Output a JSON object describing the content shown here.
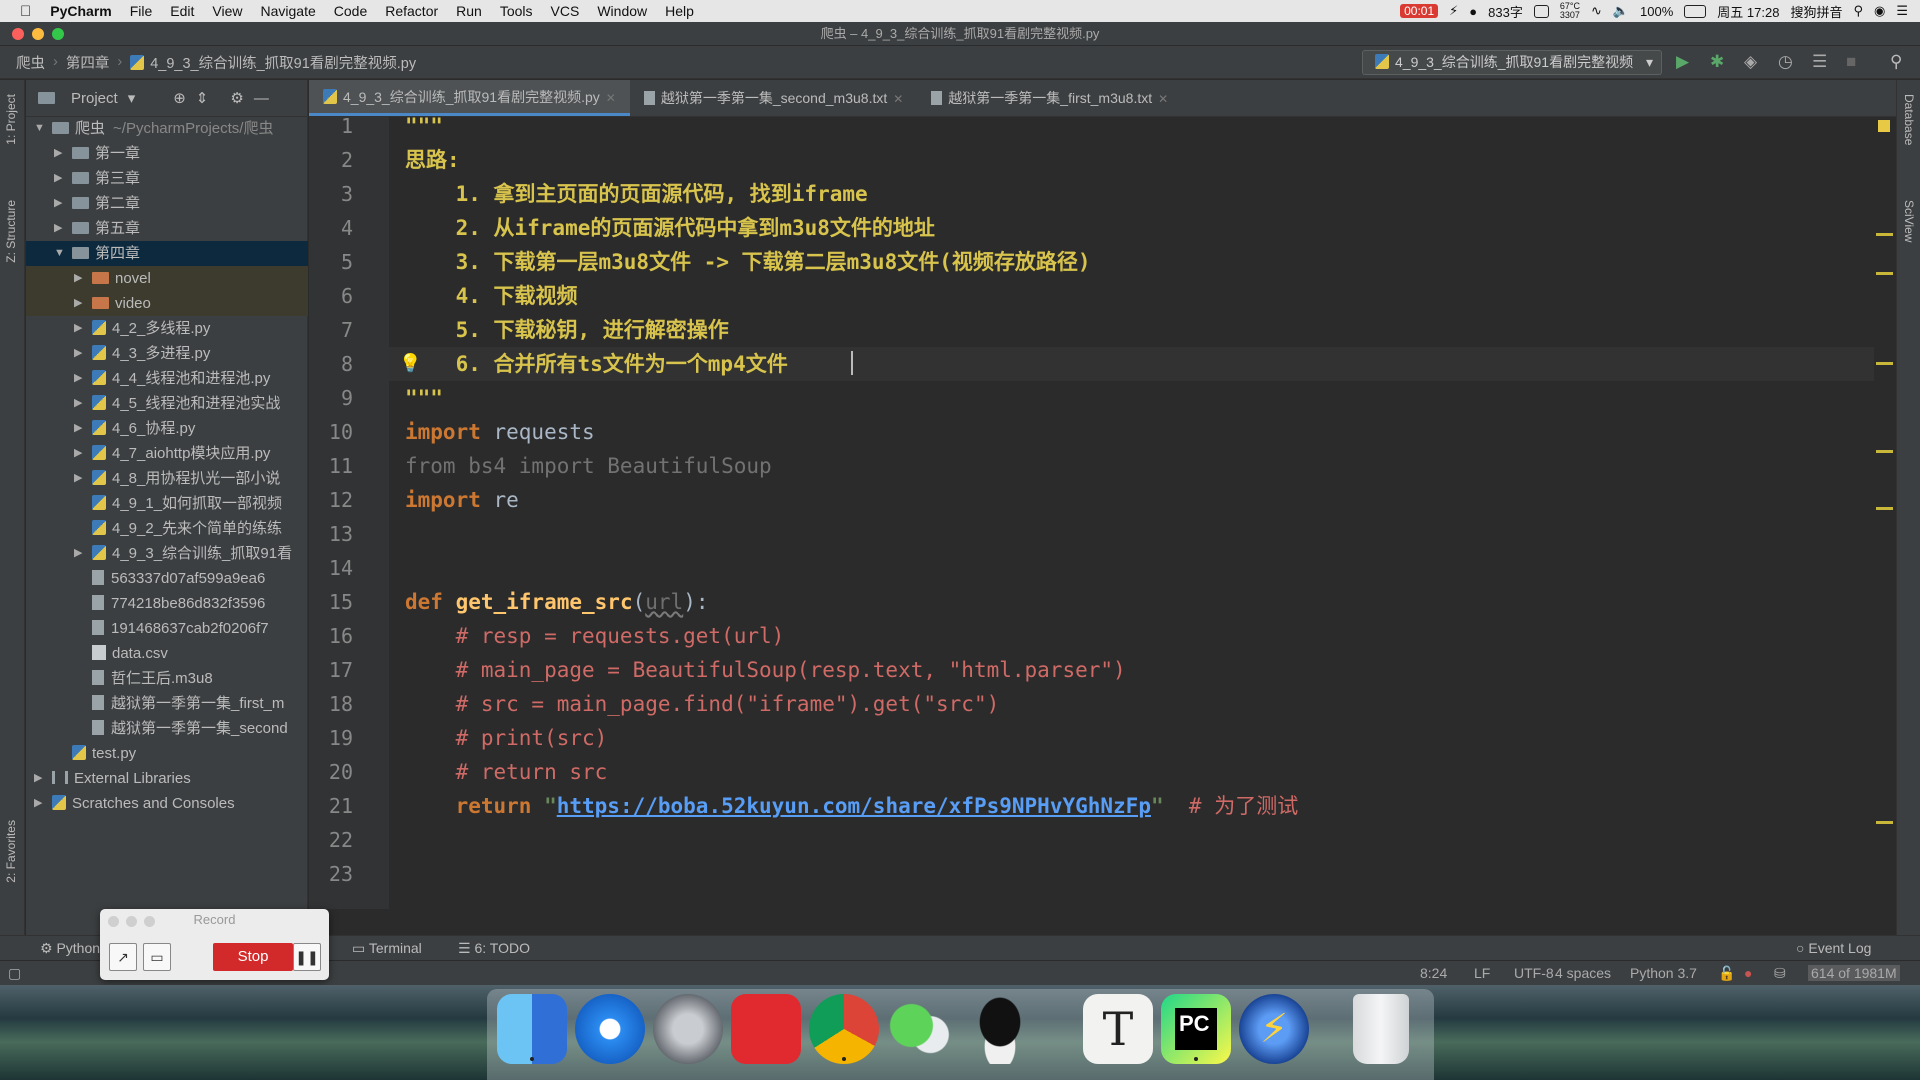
{
  "menubar": {
    "app": "PyCharm",
    "items": [
      "File",
      "Edit",
      "View",
      "Navigate",
      "Code",
      "Refactor",
      "Run",
      "Tools",
      "VCS",
      "Window",
      "Help"
    ],
    "status": {
      "record_time": "00:01",
      "char_count": "833字",
      "temp": "67°C",
      "rpm": "3307",
      "battery": "100%",
      "datetime": "周五 17:28",
      "input_method": "搜狗拼音"
    }
  },
  "window": {
    "title": "爬虫 – 4_9_3_综合训练_抓取91看剧完整视频.py"
  },
  "navbar": {
    "breadcrumb": [
      "爬虫",
      "第四章",
      "4_9_3_综合训练_抓取91看剧完整视频.py"
    ],
    "run_config": "4_9_3_综合训练_抓取91看剧完整视频"
  },
  "left_stripe": {
    "project": "1: Project",
    "structure": "Z: Structure",
    "favorites": "2: Favorites"
  },
  "right_stripe": {
    "database": "Database",
    "sciview": "SciView"
  },
  "project_panel": {
    "title": "Project",
    "tree": [
      {
        "label": "爬虫",
        "extra": "~/PycharmProjects/爬虫",
        "type": "folder",
        "depth": 0,
        "expanded": true
      },
      {
        "label": "第一章",
        "type": "folder",
        "depth": 1,
        "expanded": false
      },
      {
        "label": "第三章",
        "type": "folder",
        "depth": 1,
        "expanded": false
      },
      {
        "label": "第二章",
        "type": "folder",
        "depth": 1,
        "expanded": false
      },
      {
        "label": "第五章",
        "type": "folder",
        "depth": 1,
        "expanded": false
      },
      {
        "label": "第四章",
        "type": "folder",
        "depth": 1,
        "expanded": true,
        "selected": true
      },
      {
        "label": "novel",
        "type": "folder-orange",
        "depth": 2,
        "expanded": false
      },
      {
        "label": "video",
        "type": "folder-orange",
        "depth": 2,
        "expanded": false
      },
      {
        "label": "4_2_多线程.py",
        "type": "py",
        "depth": 2,
        "expanded": false
      },
      {
        "label": "4_3_多进程.py",
        "type": "py",
        "depth": 2,
        "expanded": false
      },
      {
        "label": "4_4_线程池和进程池.py",
        "type": "py",
        "depth": 2,
        "expanded": false
      },
      {
        "label": "4_5_线程池和进程池实战",
        "type": "py",
        "depth": 2,
        "expanded": false
      },
      {
        "label": "4_6_协程.py",
        "type": "py",
        "depth": 2,
        "expanded": false
      },
      {
        "label": "4_7_aiohttp模块应用.py",
        "type": "py",
        "depth": 2,
        "expanded": false
      },
      {
        "label": "4_8_用协程扒光一部小说",
        "type": "py",
        "depth": 2,
        "expanded": false
      },
      {
        "label": "4_9_1_如何抓取一部视频",
        "type": "py",
        "depth": 2
      },
      {
        "label": "4_9_2_先来个简单的练练",
        "type": "py",
        "depth": 2
      },
      {
        "label": "4_9_3_综合训练_抓取91看",
        "type": "py",
        "depth": 2,
        "expanded": false
      },
      {
        "label": "563337d07af599a9ea6",
        "type": "txt",
        "depth": 2
      },
      {
        "label": "774218be86d832f3596",
        "type": "txt",
        "depth": 2
      },
      {
        "label": "191468637cab2f0206f7",
        "type": "txt",
        "depth": 2
      },
      {
        "label": "data.csv",
        "type": "csv",
        "depth": 2
      },
      {
        "label": "哲仁王后.m3u8",
        "type": "txt",
        "depth": 2
      },
      {
        "label": "越狱第一季第一集_first_m",
        "type": "txt",
        "depth": 2
      },
      {
        "label": "越狱第一季第一集_second",
        "type": "txt",
        "depth": 2
      },
      {
        "label": "test.py",
        "type": "py",
        "depth": 1
      },
      {
        "label": "External Libraries",
        "type": "lib",
        "depth": 0,
        "expanded": false
      },
      {
        "label": "Scratches and Consoles",
        "type": "scratch",
        "depth": 0,
        "expanded": false
      }
    ]
  },
  "tabs": [
    {
      "label": "4_9_3_综合训练_抓取91看剧完整视频.py",
      "active": true
    },
    {
      "label": "越狱第一季第一集_second_m3u8.txt",
      "active": false
    },
    {
      "label": "越狱第一季第一集_first_m3u8.txt",
      "active": false
    }
  ],
  "code": {
    "lines": [
      {
        "n": "1",
        "parts": [
          [
            "doc",
            "\"\"\""
          ]
        ]
      },
      {
        "n": "2",
        "parts": [
          [
            "doc",
            "思路:"
          ]
        ]
      },
      {
        "n": "3",
        "parts": [
          [
            "doc",
            "    1. 拿到主页面的页面源代码, 找到iframe"
          ]
        ]
      },
      {
        "n": "4",
        "parts": [
          [
            "doc",
            "    2. 从iframe的页面源代码中拿到m3u8文件的地址"
          ]
        ]
      },
      {
        "n": "5",
        "parts": [
          [
            "doc",
            "    3. 下载第一层m3u8文件 -> 下载第二层m3u8文件(视频存放路径)"
          ]
        ]
      },
      {
        "n": "6",
        "parts": [
          [
            "doc",
            "    4. 下载视频"
          ]
        ]
      },
      {
        "n": "7",
        "parts": [
          [
            "doc",
            "    5. 下载秘钥, 进行解密操作"
          ]
        ]
      },
      {
        "n": "8",
        "parts": [
          [
            "doc",
            "    6. 合并所有ts文件为一个mp4文件"
          ]
        ]
      },
      {
        "n": "9",
        "parts": [
          [
            "doc",
            "\"\"\""
          ]
        ]
      },
      {
        "n": "10",
        "parts": [
          [
            "kw",
            "import"
          ],
          [
            "mod",
            " requests"
          ]
        ]
      },
      {
        "n": "11",
        "parts": [
          [
            "unused",
            "from bs4 import BeautifulSoup"
          ]
        ]
      },
      {
        "n": "12",
        "parts": [
          [
            "kw",
            "import"
          ],
          [
            "mod",
            " re"
          ]
        ]
      },
      {
        "n": "13",
        "parts": []
      },
      {
        "n": "14",
        "parts": []
      },
      {
        "n": "15",
        "parts": [
          [
            "kw",
            "def "
          ],
          [
            "fn",
            "get_iframe_src"
          ],
          [
            "punc",
            "("
          ],
          [
            "param",
            "url"
          ],
          [
            "punc",
            "):"
          ]
        ]
      },
      {
        "n": "16",
        "parts": [
          [
            "cm",
            "    # resp = requests.get(url)"
          ]
        ]
      },
      {
        "n": "17",
        "parts": [
          [
            "cm",
            "    # main_page = BeautifulSoup(resp.text, \"html.parser\")"
          ]
        ]
      },
      {
        "n": "18",
        "parts": [
          [
            "cm",
            "    # src = main_page.find(\"iframe\").get(\"src\")"
          ]
        ]
      },
      {
        "n": "19",
        "parts": [
          [
            "cm",
            "    # print(src)"
          ]
        ]
      },
      {
        "n": "20",
        "parts": [
          [
            "cm",
            "    # return src"
          ]
        ]
      },
      {
        "n": "21",
        "parts": [
          [
            "kw",
            "    return "
          ],
          [
            "str",
            "\""
          ],
          [
            "url",
            "https://boba.52kuyun.com/share/xfPs9NPHvYGhNzFp"
          ],
          [
            "str",
            "\""
          ],
          [
            "cm",
            "  # 为了测试"
          ]
        ]
      },
      {
        "n": "22",
        "parts": []
      },
      {
        "n": "23",
        "parts": []
      }
    ]
  },
  "bottom_tools": {
    "python_console": "Python",
    "terminal": "Terminal",
    "todo": "6: TODO",
    "event_log": "Event Log"
  },
  "statusbar": {
    "position": "8:24",
    "line_sep": "LF",
    "encoding": "UTF-8",
    "indent": "4 spaces",
    "interpreter": "Python 3.7",
    "memory": "614 of 1981M"
  },
  "record_widget": {
    "title": "Record",
    "stop_label": "Stop"
  },
  "dock": [
    "finder-icon",
    "safari-icon",
    "launchpad-icon",
    "netease-music-icon",
    "chrome-icon",
    "wechat-icon",
    "qq-icon",
    "typora-icon",
    "pycharm-icon",
    "thunder-icon",
    "trash-icon"
  ],
  "colors": {
    "accent": "#4a88c7",
    "docstring": "#d8c44c",
    "keyword": "#cc7832",
    "comment": "#cf6a66",
    "function": "#ffc66d",
    "url": "#589df6"
  }
}
